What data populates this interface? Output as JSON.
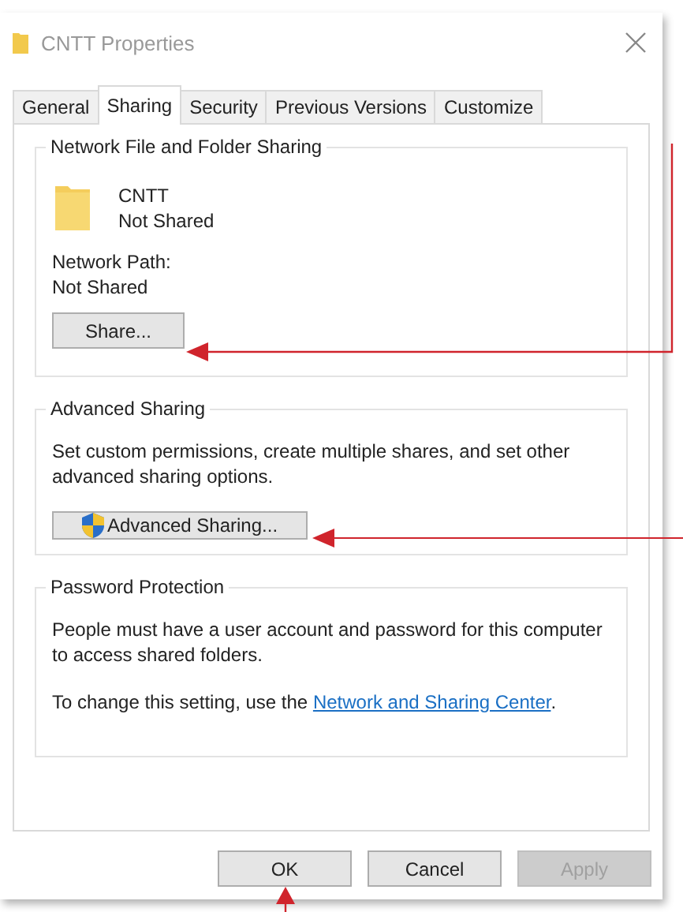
{
  "window": {
    "title": "CNTT Properties"
  },
  "tabs": [
    {
      "label": "General",
      "selected": false
    },
    {
      "label": "Sharing",
      "selected": true
    },
    {
      "label": "Security",
      "selected": false
    },
    {
      "label": "Previous Versions",
      "selected": false
    },
    {
      "label": "Customize",
      "selected": false
    }
  ],
  "network_sharing": {
    "title": "Network File and Folder Sharing",
    "folder_name": "CNTT",
    "folder_status": "Not Shared",
    "path_label": "Network Path:",
    "path_value": "Not Shared",
    "button": "Share..."
  },
  "advanced_sharing": {
    "title": "Advanced Sharing",
    "description": "Set custom permissions, create multiple shares, and set other advanced sharing options.",
    "button": "Advanced Sharing..."
  },
  "password_protection": {
    "title": "Password Protection",
    "description": "People must have a user account and password for this computer to access shared folders.",
    "change_text": "To change this setting, use the",
    "link": "Network and Sharing Center",
    "after_link": "."
  },
  "buttons": [
    {
      "label": "OK",
      "disabled": false
    },
    {
      "label": "Cancel",
      "disabled": false
    },
    {
      "label": "Apply",
      "disabled": true
    }
  ]
}
